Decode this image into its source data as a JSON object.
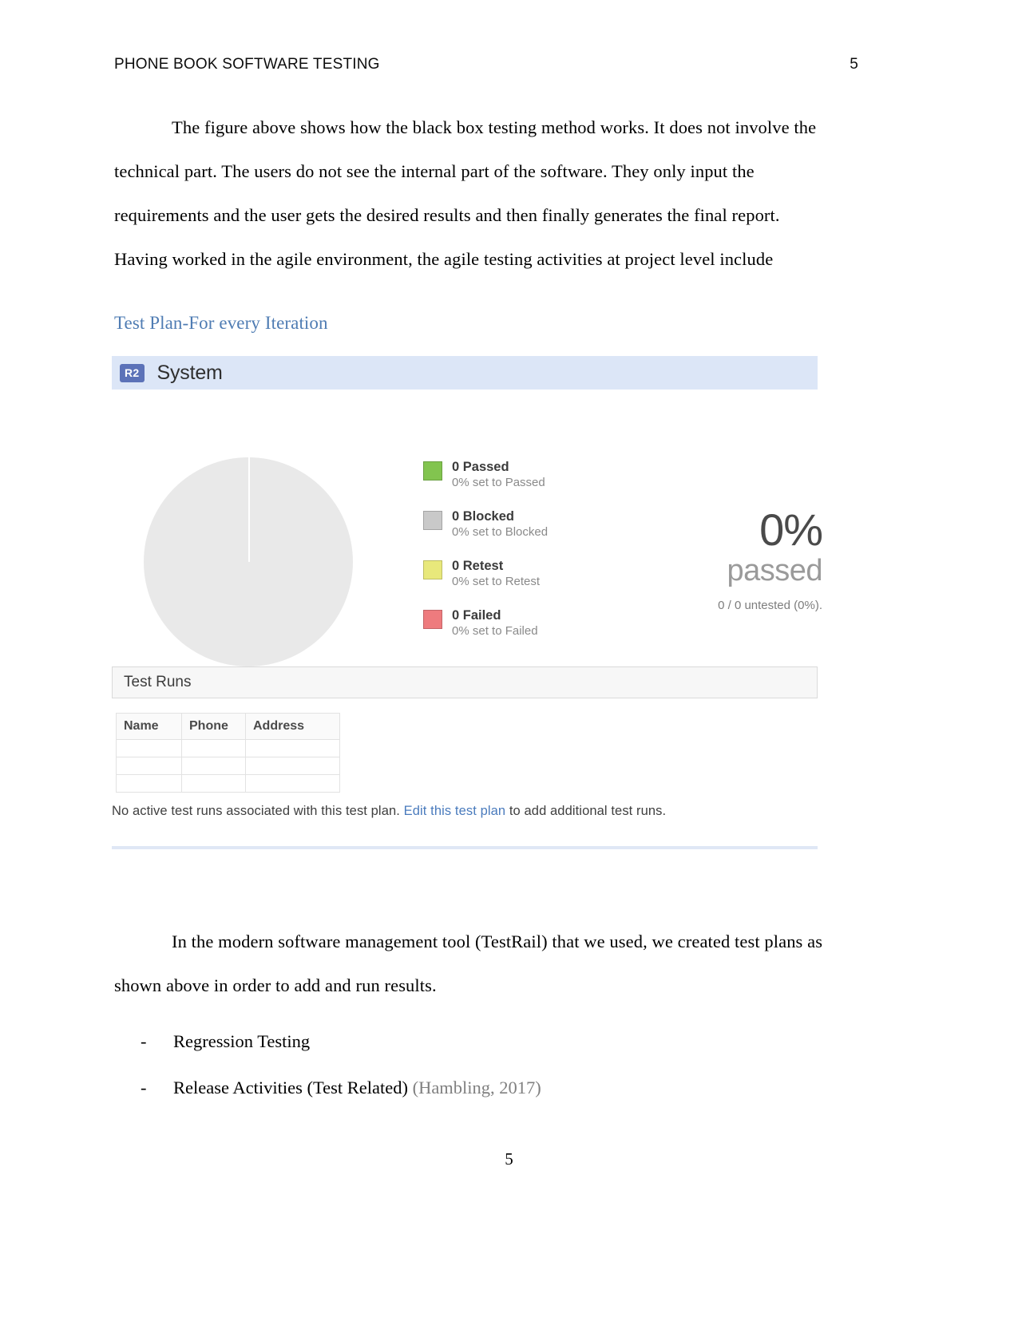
{
  "header": {
    "running_title": "PHONE BOOK SOFTWARE TESTING",
    "page_number": "5"
  },
  "body": {
    "paragraph_1": "The figure above shows how the black box testing method works. It does not involve the",
    "paragraph_2": "technical part. The users do not see the internal part of the software. They only input the",
    "paragraph_3": "requirements and the user gets the desired results and then finally generates the final report.",
    "paragraph_4": "Having worked in the agile environment, the agile testing activities at project level include",
    "heading_blue": "Test Plan-For every Iteration"
  },
  "screenshot": {
    "header": {
      "badge": "R2",
      "title": "System"
    },
    "legend": [
      {
        "label": "0 Passed",
        "sub": "0% set to Passed",
        "color": "#82c44f"
      },
      {
        "label": "0 Blocked",
        "sub": "0% set to Blocked",
        "color": "#c9c9c9"
      },
      {
        "label": "0 Retest",
        "sub": "0% set to Retest",
        "color": "#e8e87b"
      },
      {
        "label": "0 Failed",
        "sub": "0% set to Failed",
        "color": "#ee7b7e"
      }
    ],
    "summary": {
      "percent": "0%",
      "percent_word": "passed",
      "untested": "0 / 0 untested (0%)."
    },
    "test_runs": {
      "section_title": "Test Runs",
      "columns": [
        "Name",
        "Phone",
        "Address",
        ""
      ],
      "rows": [
        [
          "",
          "",
          "",
          ""
        ],
        [
          "",
          "",
          "",
          ""
        ],
        [
          "",
          "",
          "",
          ""
        ]
      ],
      "note_before_link": "No active test runs associated with this test plan. ",
      "note_link": "Edit this test plan",
      "note_after_link": " to add additional test runs."
    }
  },
  "tail": {
    "paragraph_1": "In the modern software management tool (TestRail) that we used, we created test plans as",
    "paragraph_2": "shown above in order to add and run results.",
    "bullets": [
      {
        "dash": "-",
        "text": "Regression Testing",
        "citation": ""
      },
      {
        "dash": "-",
        "text": "Release Activities (Test Related) ",
        "citation": "(Hambling, 2017)"
      }
    ]
  },
  "footer": {
    "page_number": "5"
  },
  "chart_data": {
    "type": "pie",
    "title": "System",
    "categories": [
      "Passed",
      "Blocked",
      "Retest",
      "Failed",
      "Untested"
    ],
    "values": [
      0,
      0,
      0,
      0,
      0
    ],
    "value_labels": [
      "0 Passed",
      "0 Blocked",
      "0 Retest",
      "0 Failed"
    ],
    "percent_labels": [
      "0% set to Passed",
      "0% set to Blocked",
      "0% set to Retest",
      "0% set to Failed"
    ],
    "colors": [
      "#82c44f",
      "#c9c9c9",
      "#e8e87b",
      "#ee7b7e",
      "#e9e9e9"
    ],
    "summary_percent": "0%",
    "summary_word": "passed",
    "summary_detail": "0 / 0 untested (0%).",
    "legend_position": "right",
    "grid": false
  }
}
